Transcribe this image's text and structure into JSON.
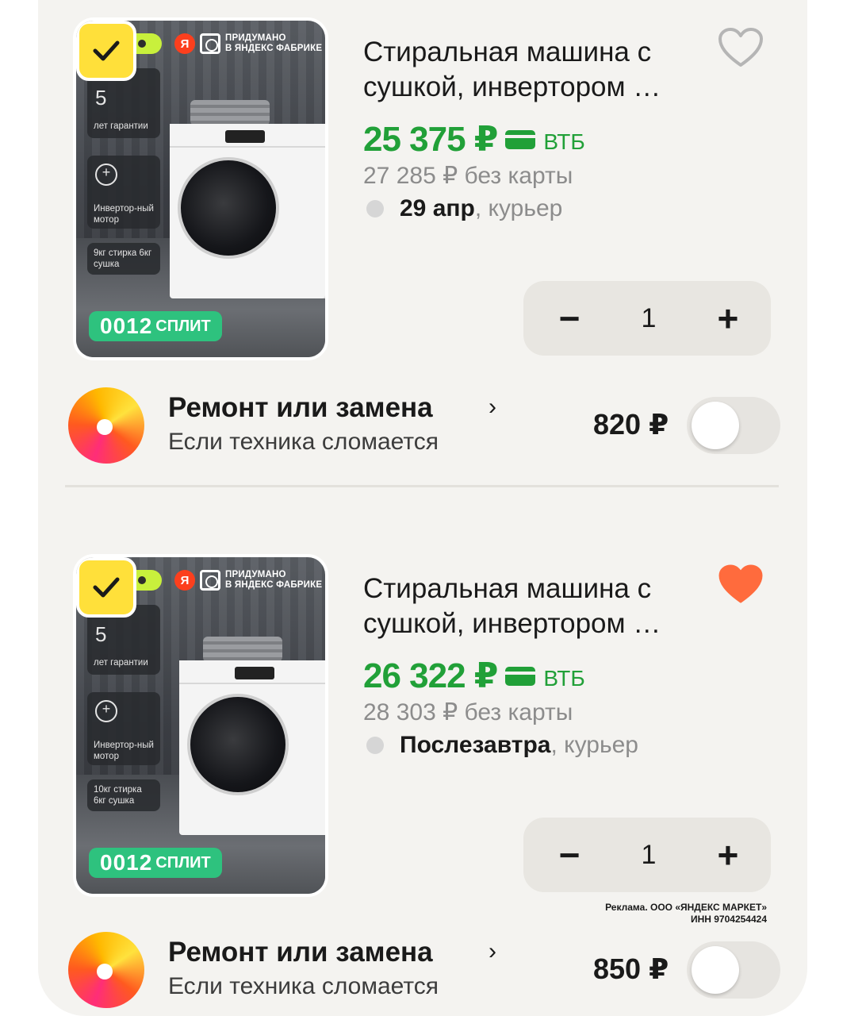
{
  "items": [
    {
      "product": {
        "title": "Стиральная машина с сушкой, инвертором …",
        "price": "25 375 ₽",
        "bank": "ВТБ",
        "old_price": "27 285 ₽  без карты",
        "delivery_date": "29 апр",
        "delivery_method": ", курьер",
        "favorite": false,
        "selected": true
      },
      "image": {
        "brand_line1": "Придумано",
        "brand_line2": "в Яндекс Фабрике",
        "ya_letter": "Я",
        "warranty_num": "5",
        "warranty_label": "лет гарантии",
        "motor_label": "Инвертор-ный мотор",
        "size_label": "9кг стирка 6кг сушка",
        "split_num": "0012",
        "split_label": "СПЛИТ"
      },
      "quantity": {
        "minus": "−",
        "value": "1",
        "plus": "+"
      },
      "service": {
        "title": "Ремонт или замена",
        "chevron": "›",
        "subtitle": "Если техника сломается",
        "price": "820 ₽",
        "enabled": false
      }
    },
    {
      "product": {
        "title": "Стиральная машина с сушкой, инвертором …",
        "price": "26 322 ₽",
        "bank": "ВТБ",
        "old_price": "28 303 ₽  без карты",
        "delivery_date": "Послезавтра",
        "delivery_method": ", курьер",
        "favorite": true,
        "selected": true
      },
      "image": {
        "brand_line1": "Придумано",
        "brand_line2": "в Яндекс Фабрике",
        "ya_letter": "Я",
        "warranty_num": "5",
        "warranty_label": "лет гарантии",
        "motor_label": "Инвертор-ный мотор",
        "size_label": "10кг стирка 6кг сушка",
        "split_num": "0012",
        "split_label": "СПЛИТ"
      },
      "quantity": {
        "minus": "−",
        "value": "1",
        "plus": "+"
      },
      "service": {
        "title": "Ремонт или замена",
        "chevron": "›",
        "subtitle": "Если техника сломается",
        "price": "850 ₽",
        "enabled": false
      }
    }
  ],
  "ad_note": {
    "line1": "Реклама. ООО «ЯНДЕКС МАРКЕТ»",
    "line2": "ИНН 9704254424"
  },
  "colors": {
    "price_green": "#21a038",
    "heart_active": "#ff6b3d",
    "check_yellow": "#ffe03a",
    "split_green": "#2ec27e"
  },
  "icons": {
    "check": "check-icon",
    "heart": "heart-icon",
    "card": "bank-card-icon",
    "delivery": "delivery-dot-icon"
  }
}
